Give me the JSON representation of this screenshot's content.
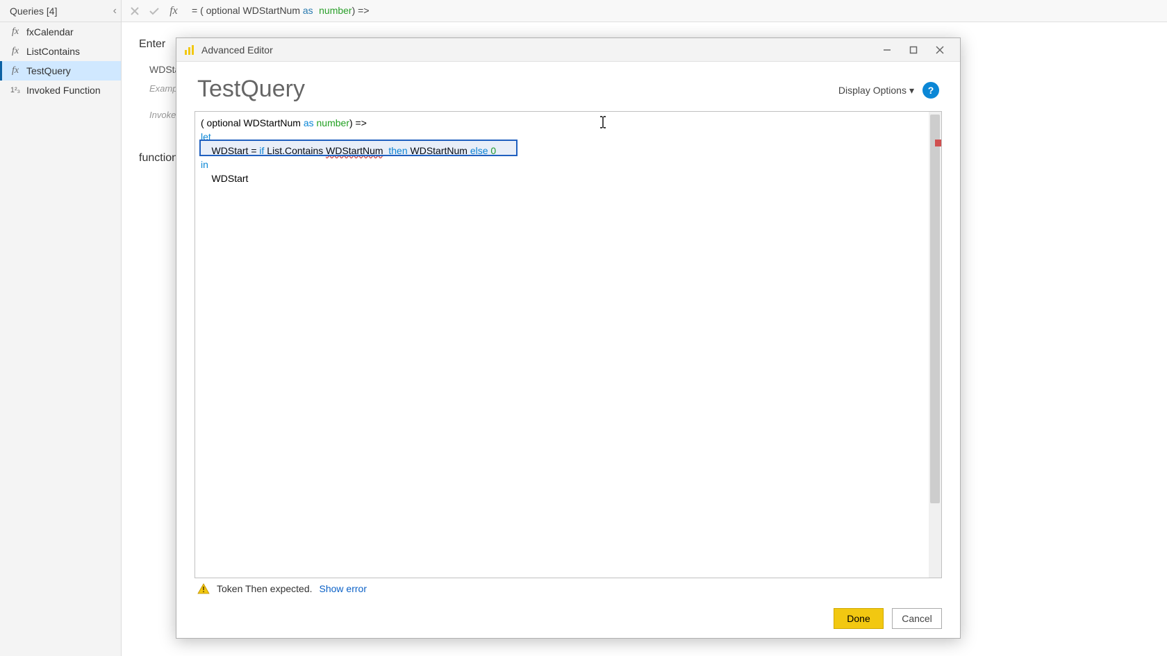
{
  "sidebar": {
    "title": "Queries [4]",
    "items": [
      {
        "icon": "fx",
        "label": "fxCalendar"
      },
      {
        "icon": "fx",
        "label": "ListContains"
      },
      {
        "icon": "fx",
        "label": "TestQuery"
      },
      {
        "icon": "1²₃",
        "label": "Invoked Function"
      }
    ]
  },
  "formula_bar": {
    "prefix": "= ( optional WDStartNum ",
    "kw_as": "as",
    "type_number": "number",
    "suffix": ") =>"
  },
  "behind": {
    "enter": "Enter",
    "wdstart": "WDStart",
    "example": "Example",
    "invoke": "Invoke",
    "function": "function"
  },
  "modal": {
    "title": "Advanced Editor",
    "query_name": "TestQuery",
    "display_options": "Display Options",
    "code": {
      "l1a": "( optional WDStartNum ",
      "l1as": "as",
      "l1sp": " ",
      "l1num": "number",
      "l1b": ") =>",
      "l2": "let",
      "l3a": "    WDStart = ",
      "l3if": "if",
      "l3b": " List.Contains ",
      "l3err": "WDStartNum",
      "l3sp2": "  ",
      "l3then": "then",
      "l3c": " WDStartNum ",
      "l3else": "else",
      "l3d": " ",
      "l3zero": "0",
      "l4": "in",
      "l5": "    WDStart"
    },
    "error_text": "Token Then expected.",
    "show_error": "Show error",
    "done": "Done",
    "cancel": "Cancel"
  }
}
